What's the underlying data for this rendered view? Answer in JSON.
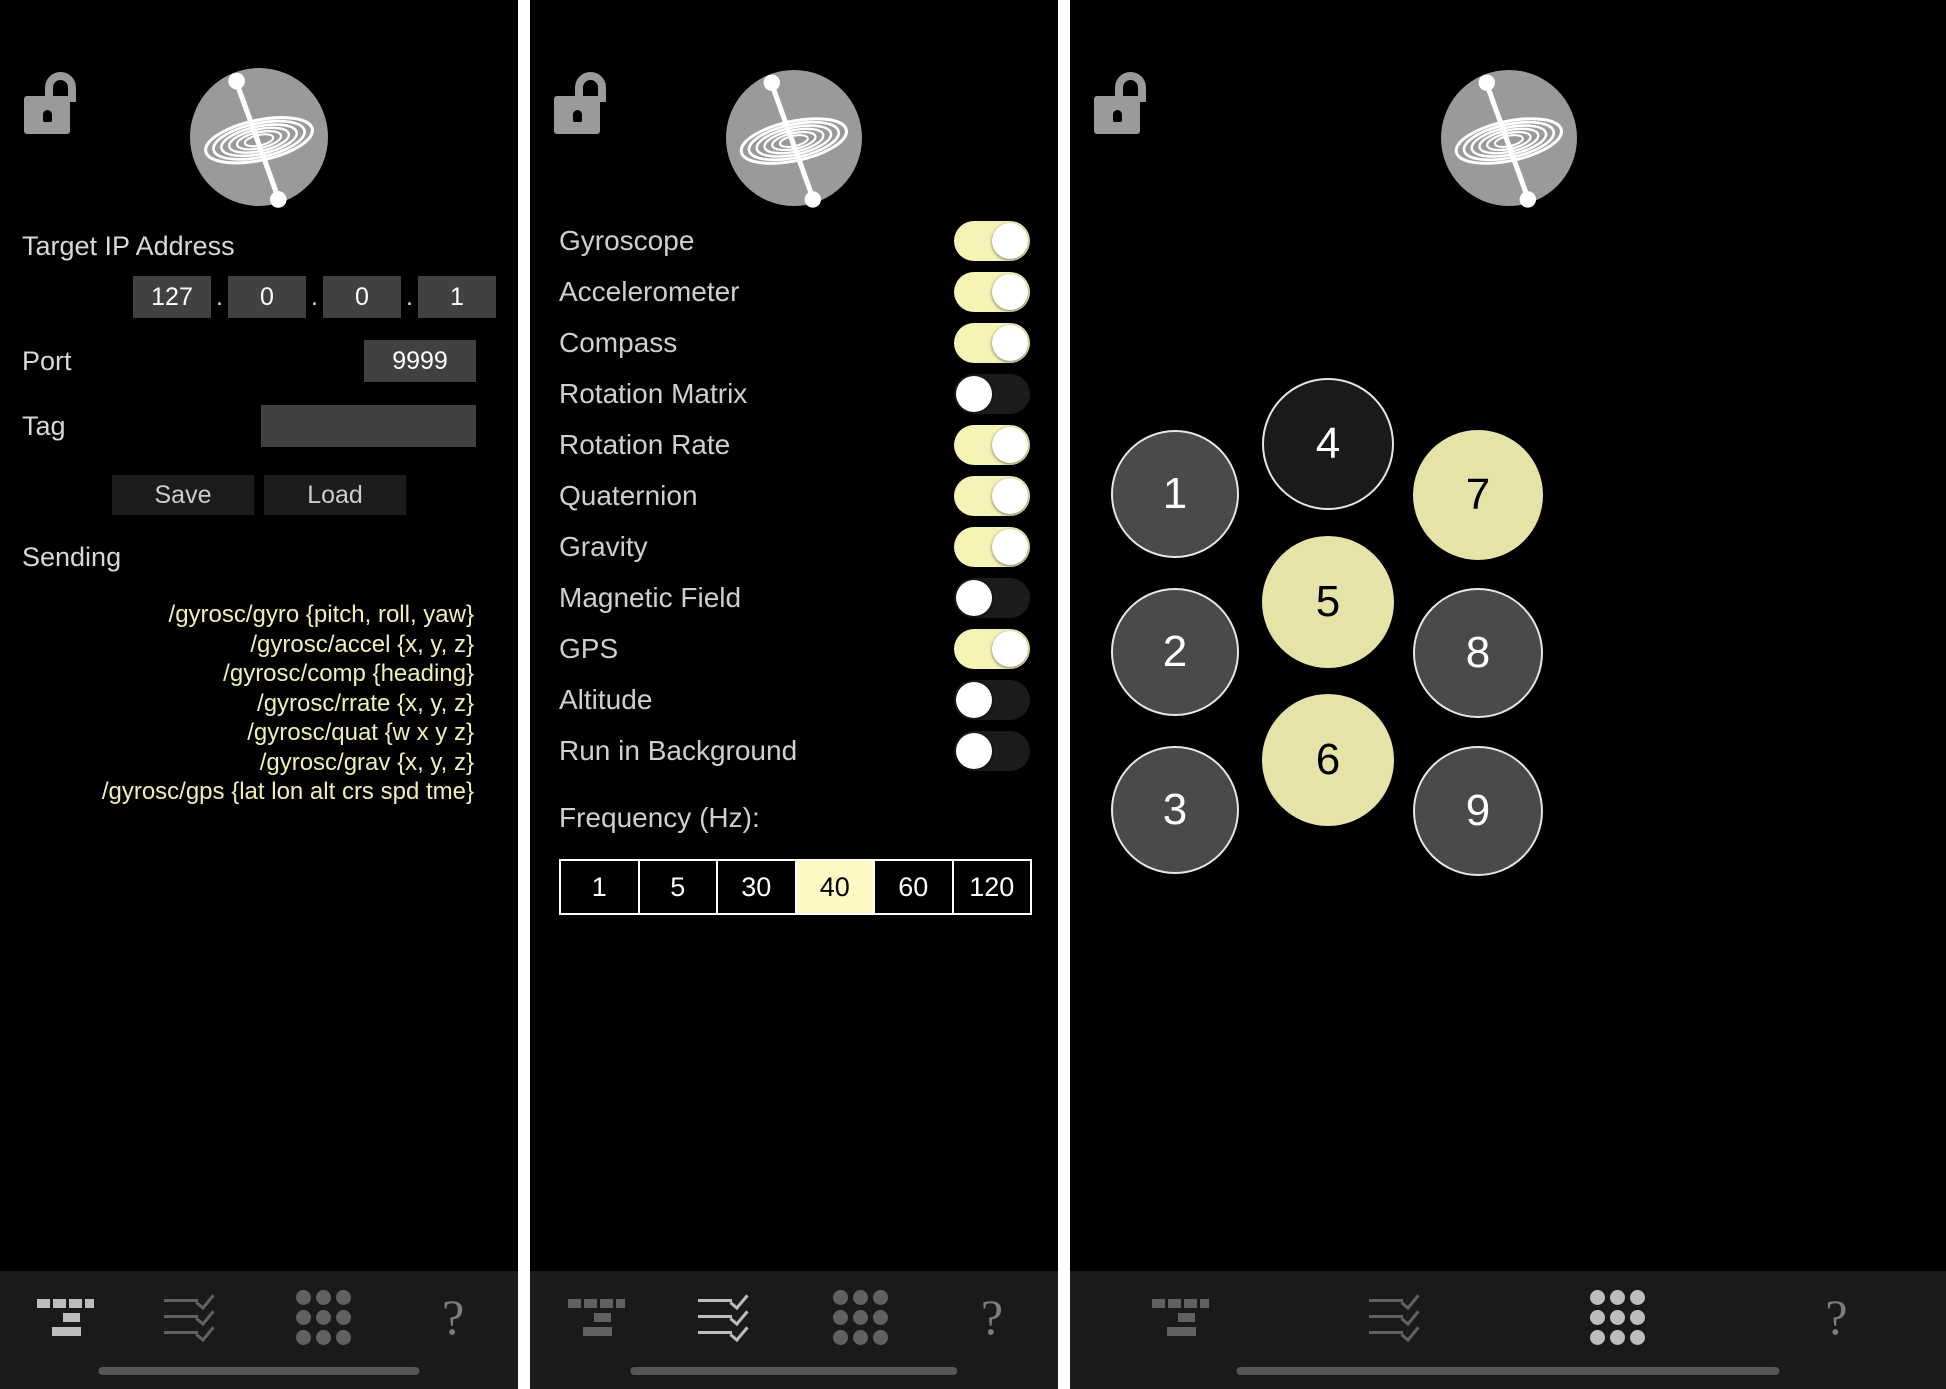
{
  "app": {
    "logo_name": "gyroscope-logo",
    "lock_state": "unlocked",
    "accent": "#f0efb4",
    "switch_on_color": "#f6f3b6",
    "background": "#000000"
  },
  "panel_config": {
    "ip_label": "Target IP Address",
    "ip_octets": [
      "127",
      "0",
      "0",
      "1"
    ],
    "ip_separator": ".",
    "port_label": "Port",
    "port_value": "9999",
    "tag_label": "Tag",
    "tag_value": "",
    "tag_placeholder": "",
    "save_label": "Save",
    "load_label": "Load",
    "sending_label": "Sending",
    "osc_messages": [
      "/gyrosc/gyro {pitch, roll, yaw}",
      "/gyrosc/accel {x, y, z}",
      "/gyrosc/comp {heading}",
      "/gyrosc/rrate {x, y, z}",
      "/gyrosc/quat {w x y z}",
      "/gyrosc/grav {x, y, z}",
      "/gyrosc/gps {lat lon alt crs spd tme}"
    ]
  },
  "panel_sensors": {
    "items": [
      {
        "label": "Gyroscope",
        "enabled": true
      },
      {
        "label": "Accelerometer",
        "enabled": true
      },
      {
        "label": "Compass",
        "enabled": true
      },
      {
        "label": "Rotation Matrix",
        "enabled": false
      },
      {
        "label": "Rotation Rate",
        "enabled": true
      },
      {
        "label": "Quaternion",
        "enabled": true
      },
      {
        "label": "Gravity",
        "enabled": true
      },
      {
        "label": "Magnetic Field",
        "enabled": false
      },
      {
        "label": "GPS",
        "enabled": true
      },
      {
        "label": "Altitude",
        "enabled": false
      },
      {
        "label": "Run in Background",
        "enabled": false
      }
    ],
    "frequency_label": "Frequency (Hz):",
    "frequency_options": [
      "1",
      "5",
      "30",
      "40",
      "60",
      "120"
    ],
    "frequency_selected": "40"
  },
  "panel_pad": {
    "buttons": [
      {
        "label": "1",
        "state": "grey"
      },
      {
        "label": "2",
        "state": "grey"
      },
      {
        "label": "3",
        "state": "grey"
      },
      {
        "label": "4",
        "state": "dark"
      },
      {
        "label": "5",
        "state": "yellow"
      },
      {
        "label": "6",
        "state": "yellow"
      },
      {
        "label": "7",
        "state": "yellow"
      },
      {
        "label": "8",
        "state": "grey"
      },
      {
        "label": "9",
        "state": "grey"
      }
    ]
  },
  "nav": {
    "items": [
      {
        "name": "config-tab",
        "icon": "sliders-icon"
      },
      {
        "name": "sensors-tab",
        "icon": "checklist-icon"
      },
      {
        "name": "pad-tab",
        "icon": "dot-grid-icon"
      },
      {
        "name": "help-tab",
        "icon": "question-mark-icon",
        "label": "?"
      }
    ],
    "active": [
      "config-tab",
      "sensors-tab",
      "pad-tab"
    ]
  }
}
